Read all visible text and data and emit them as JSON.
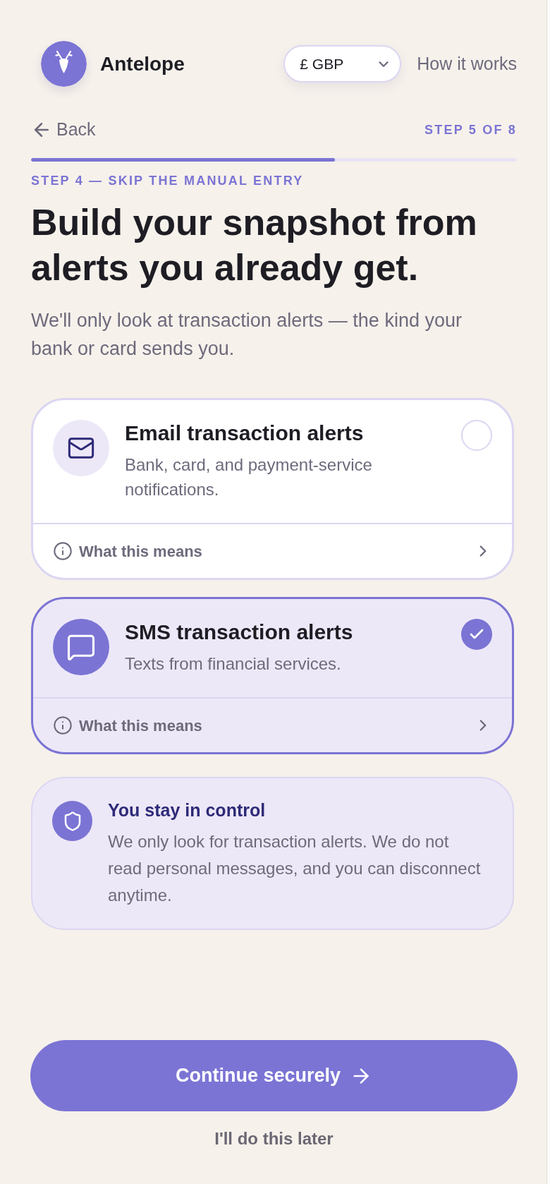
{
  "header": {
    "brand": "Antelope",
    "currency_select": {
      "value": "£ GBP"
    },
    "link": "How it works"
  },
  "nav": {
    "back": "Back",
    "step": "STEP 5 OF 8",
    "progress": {
      "level": 0.625
    }
  },
  "intro": {
    "eyebrow": "STEP 4 — SKIP THE MANUAL ENTRY",
    "title": "Build your snapshot from alerts you already get.",
    "subtitle": "We'll only look at transaction alerts — the kind your bank or card sends you."
  },
  "options": [
    {
      "kind": "email",
      "title": "Email transaction alerts",
      "description": "Bank, card, and payment-service notifications.",
      "selected": false,
      "more": "What this means"
    },
    {
      "kind": "sms",
      "title": "SMS transaction alerts",
      "description": "Texts from financial services.",
      "selected": true,
      "more": "What this means"
    }
  ],
  "notice": {
    "title": "You stay in control",
    "body": "We only look for transaction alerts. We do not read personal messages, and you can disconnect anytime."
  },
  "actions": {
    "primary": "Continue securely",
    "secondary": "I'll do this later"
  }
}
